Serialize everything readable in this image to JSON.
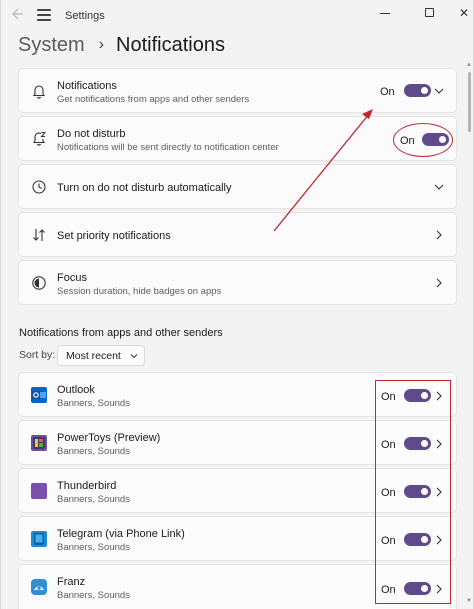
{
  "window": {
    "title": "Settings",
    "back_icon": "back-arrow-icon",
    "menu_icon": "hamburger-menu-icon",
    "minimize_icon": "minimize-icon",
    "maximize_icon": "maximize-icon",
    "close_icon": "close-icon",
    "close_glyph": "✕"
  },
  "breadcrumb": {
    "parent": "System",
    "separator": "›",
    "current": "Notifications"
  },
  "settings": [
    {
      "title": "Notifications",
      "subtitle": "Get notifications from apps and other senders",
      "icon": "bell-icon",
      "toggle_label": "On",
      "toggle_on": true,
      "expander": "chevron-down"
    },
    {
      "title": "Do not disturb",
      "subtitle": "Notifications will be sent directly to notification center",
      "icon": "bell-snooze-icon",
      "toggle_label": "On",
      "toggle_on": true
    },
    {
      "title": "Turn on do not disturb automatically",
      "icon": "clock-icon",
      "expander": "chevron-down"
    },
    {
      "title": "Set priority notifications",
      "icon": "priority-sort-icon",
      "expander": "chevron-right"
    },
    {
      "title": "Focus",
      "subtitle": "Session duration, hide badges on apps",
      "icon": "focus-icon",
      "expander": "chevron-right"
    }
  ],
  "apps_section": {
    "title": "Notifications from apps and other senders",
    "sort_label": "Sort by:",
    "sort_value": "Most recent"
  },
  "apps": [
    {
      "name": "Outlook",
      "subtitle": "Banners, Sounds",
      "toggle_label": "On",
      "toggle_on": true,
      "icon": "outlook-icon",
      "color": "#0a64c8"
    },
    {
      "name": "PowerToys (Preview)",
      "subtitle": "Banners, Sounds",
      "toggle_label": "On",
      "toggle_on": true,
      "icon": "powertoys-icon",
      "color": "#6b4fa0"
    },
    {
      "name": "Thunderbird",
      "subtitle": "Banners, Sounds",
      "toggle_label": "On",
      "toggle_on": true,
      "icon": "thunderbird-icon",
      "color": "#7a4fb0"
    },
    {
      "name": "Telegram (via Phone Link)",
      "subtitle": "Banners, Sounds",
      "toggle_label": "On",
      "toggle_on": true,
      "icon": "telegram-icon",
      "color": "#1f8ad2"
    },
    {
      "name": "Franz",
      "subtitle": "Banners, Sounds",
      "toggle_label": "On",
      "toggle_on": true,
      "icon": "franz-icon",
      "color": "#2d8fd5"
    }
  ],
  "colors": {
    "accent": "#5e4b8b",
    "annotation": "#c0272d",
    "background": "#f3f3f3",
    "card": "#fbfbfb"
  }
}
